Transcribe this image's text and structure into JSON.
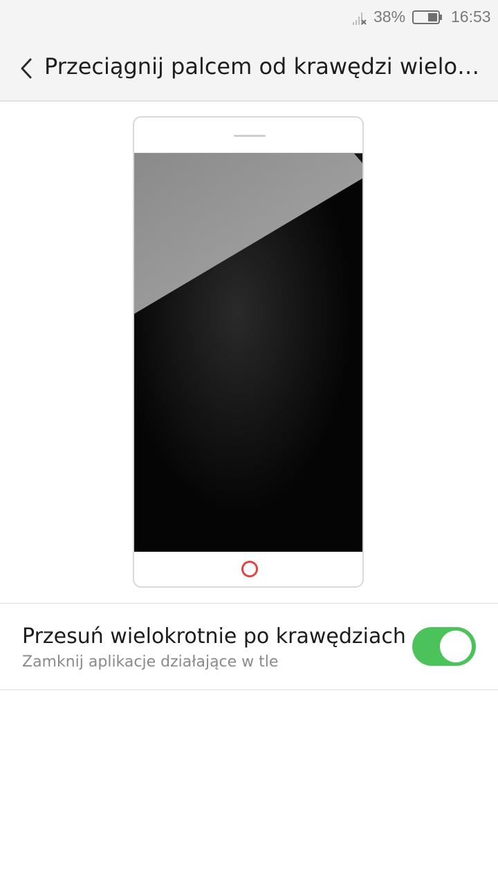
{
  "status_bar": {
    "battery_percent": "38%",
    "time": "16:53",
    "signal_icon": "signal-off-icon",
    "battery_icon": "battery-icon"
  },
  "header": {
    "back_icon": "chevron-left-icon",
    "title": "Przeciągnij palcem od krawędzi wielokrotnie"
  },
  "preview": {
    "home_icon": "home-ring-icon",
    "home_color": "#e0443e"
  },
  "setting": {
    "title": "Przesuń wielokrotnie po krawędziach",
    "subtitle": "Zamknij aplikacje działające w tle",
    "toggle_on": true,
    "toggle_color": "#4cc25b"
  }
}
